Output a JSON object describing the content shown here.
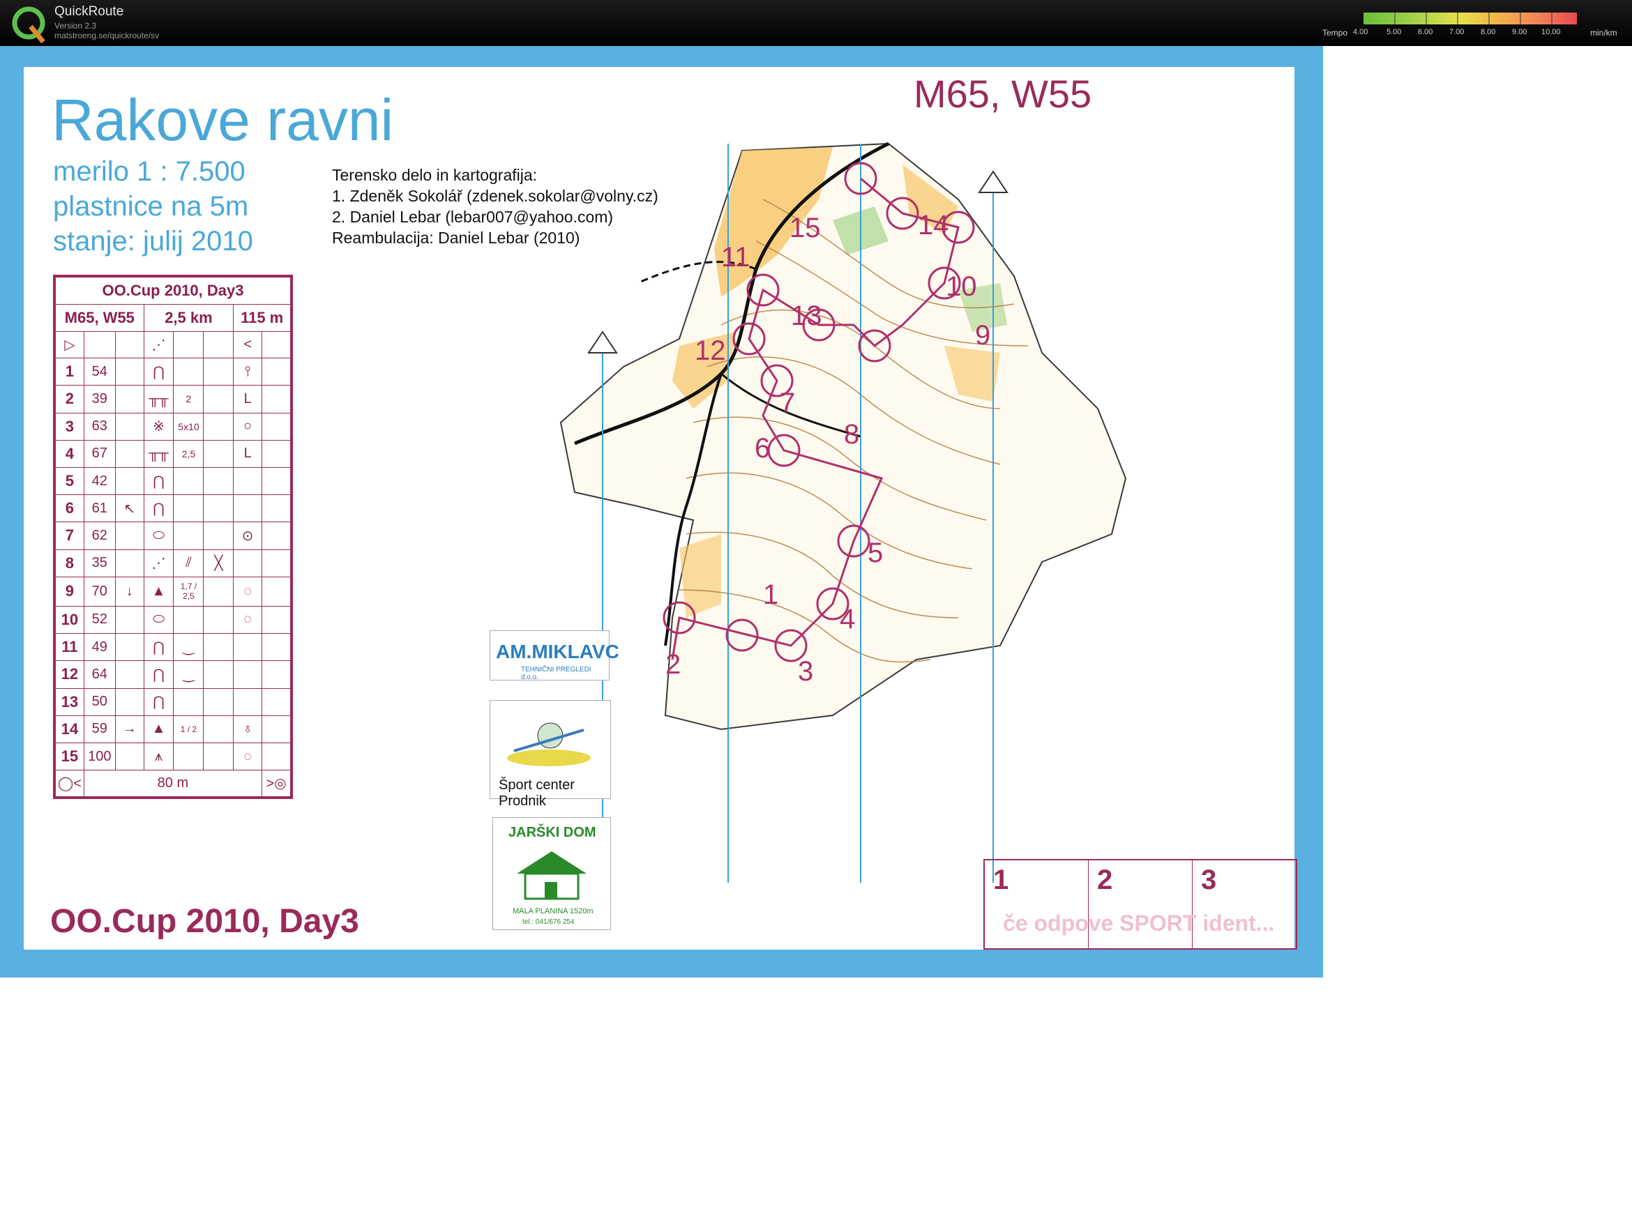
{
  "app": {
    "title": "QuickRoute",
    "version": "Version 2.3",
    "url": "matstroeng.se/quickroute/sv",
    "tempo_label": "Tempo",
    "tempo_ticks": [
      "4.00",
      "5.00",
      "6.00",
      "7.00",
      "8.00",
      "9.00",
      "10.00"
    ],
    "tempo_unit": "min/km",
    "tempo_colors": [
      "#6bbf3a",
      "#a8d24a",
      "#e6e04a",
      "#f2b14a",
      "#f07a5a",
      "#e84a4a"
    ]
  },
  "map": {
    "title": "Rakove ravni",
    "scale": "merilo 1 : 7.500",
    "contours": "plastnice na 5m",
    "state": "stanje: julij 2010",
    "credits": [
      "Terensko delo in kartografija:",
      "1. Zdeněk Sokolář (zdenek.sokolar@volny.cz)",
      "2. Daniel Lebar (lebar007@yahoo.com)",
      "Reambulacija: Daniel Lebar (2010)"
    ],
    "class_heading": "M65, W55",
    "footer_title": "OO.Cup 2010, Day3",
    "course_color": "#b0306a",
    "controls": [
      "1",
      "2",
      "3",
      "4",
      "5",
      "6",
      "7",
      "8",
      "9",
      "10",
      "11",
      "12",
      "13",
      "14",
      "15"
    ]
  },
  "description_sheet": {
    "event": "OO.Cup 2010, Day3",
    "class": "M65, W55",
    "length": "2,5 km",
    "climb": "115 m",
    "rows": [
      {
        "n": "1",
        "code": "54",
        "extra": ""
      },
      {
        "n": "2",
        "code": "39",
        "extra": "2"
      },
      {
        "n": "3",
        "code": "63",
        "extra": "5x10"
      },
      {
        "n": "4",
        "code": "67",
        "extra": "2,5"
      },
      {
        "n": "5",
        "code": "42",
        "extra": ""
      },
      {
        "n": "6",
        "code": "61",
        "extra": ""
      },
      {
        "n": "7",
        "code": "62",
        "extra": ""
      },
      {
        "n": "8",
        "code": "35",
        "extra": ""
      },
      {
        "n": "9",
        "code": "70",
        "extra": "1,7 / 2,5"
      },
      {
        "n": "10",
        "code": "52",
        "extra": ""
      },
      {
        "n": "11",
        "code": "49",
        "extra": ""
      },
      {
        "n": "12",
        "code": "64",
        "extra": ""
      },
      {
        "n": "13",
        "code": "50",
        "extra": ""
      },
      {
        "n": "14",
        "code": "59",
        "extra": "1 / 2"
      },
      {
        "n": "15",
        "code": "100",
        "extra": ""
      }
    ],
    "finish_distance": "80 m"
  },
  "sponsors": {
    "miklavc": "AM.MIKLAVC",
    "miklavc_tag": "TEHNIČNI PREGLEDI d.o.o.",
    "prodnik": "Šport center Prodnik",
    "jarski": "JARŠKI DOM",
    "jarski_sub": "MALA PLANINA 1520m",
    "jarski_tel": "tel.: 041/676 254"
  },
  "si_backup": {
    "cells": [
      "1",
      "2",
      "3"
    ],
    "note": "če odpove SPORT ident..."
  }
}
